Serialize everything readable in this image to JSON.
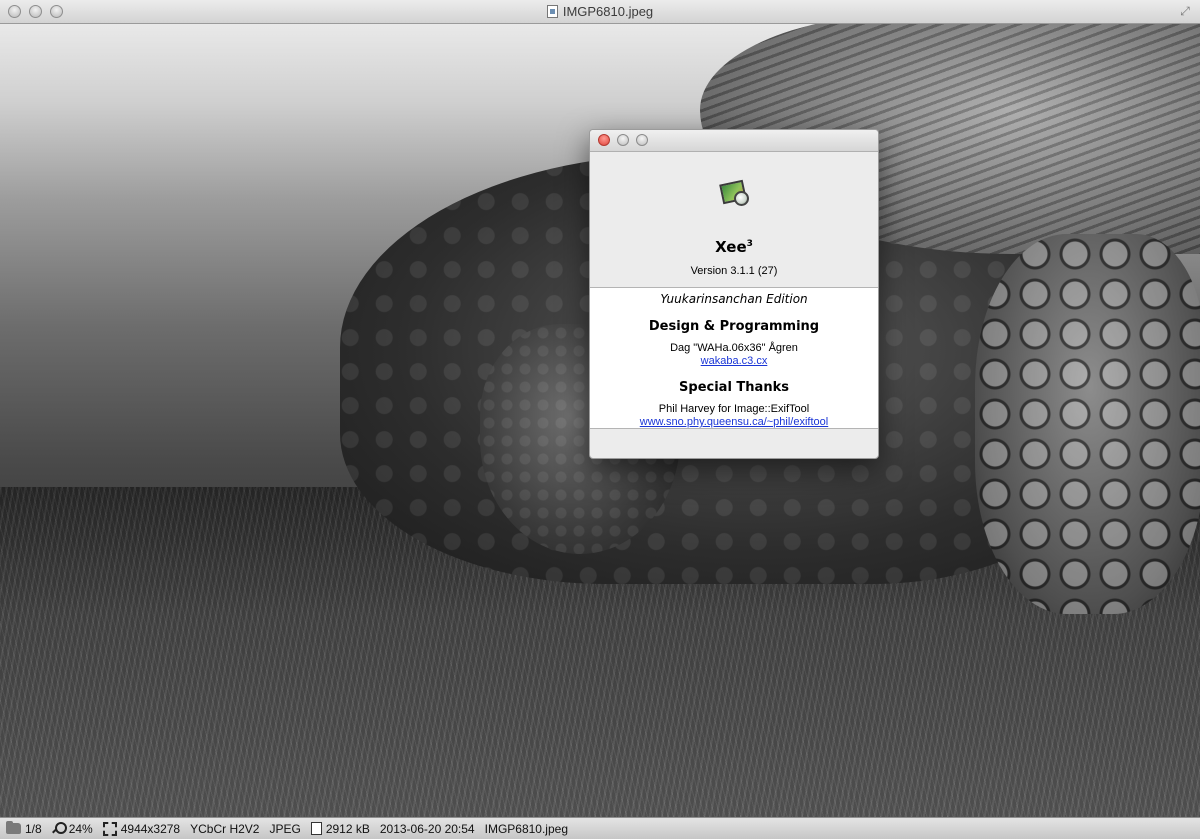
{
  "window": {
    "title": "IMGP6810.jpeg"
  },
  "statusbar": {
    "position": "1/8",
    "zoom": "24%",
    "dimensions": "4944x3278",
    "color_mode": "YCbCr H2V2",
    "format": "JPEG",
    "file_size": "2912 kB",
    "date": "2013-06-20 20:54",
    "filename": "IMGP6810.jpeg"
  },
  "about": {
    "app_name": "Xee",
    "app_name_sup": "3",
    "version": "Version 3.1.1 (27)",
    "edition": "Yuukarinsanchan Edition",
    "sections": {
      "design_title": "Design & Programming",
      "design_name": "Dag \"WAHa.06x36\" Ågren",
      "design_link": "wakaba.c3.cx",
      "thanks_title": "Special Thanks",
      "thanks_name": "Phil Harvey for Image::ExifTool",
      "thanks_link": "www.sno.phy.queensu.ca/~phil/exiftool"
    }
  },
  "icons": {
    "window_doc": "document-icon",
    "fullscreen": "fullscreen-icon",
    "folder": "folder-icon",
    "zoom": "magnifier-icon",
    "dimensions": "dimensions-icon",
    "file": "file-icon",
    "app": "xee-app-icon"
  }
}
